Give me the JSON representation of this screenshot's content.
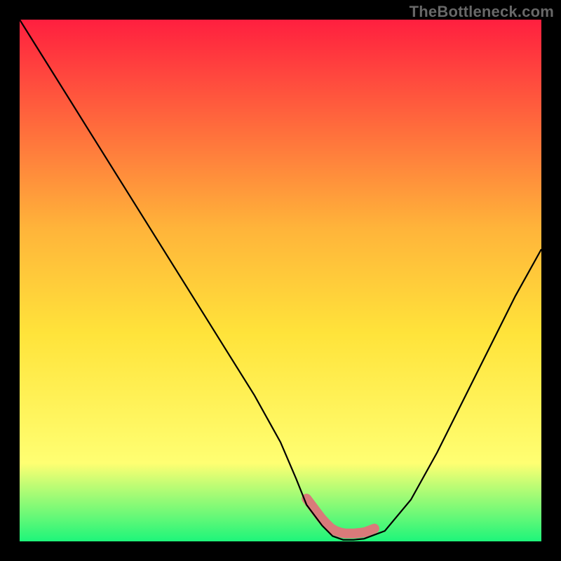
{
  "watermark": "TheBottleneck.com",
  "gradient": {
    "top": "#ff1f3f",
    "mid1": "#ffb43a",
    "mid2": "#ffe33a",
    "mid3": "#ffff72",
    "bottom": "#1ef57a"
  },
  "curve_color": "#000000",
  "curve_width": 2.2,
  "flat_marker_color": "#d97a7a",
  "flat_marker_width": 14,
  "chart_data": {
    "type": "line",
    "title": "",
    "xlabel": "",
    "ylabel": "",
    "xlim": [
      0,
      100
    ],
    "ylim": [
      0,
      100
    ],
    "x": [
      0,
      5,
      10,
      15,
      20,
      25,
      30,
      35,
      40,
      45,
      50,
      53,
      55,
      58,
      60,
      62,
      64,
      66,
      70,
      75,
      80,
      85,
      90,
      95,
      100
    ],
    "values": [
      100,
      92,
      84,
      76,
      68,
      60,
      52,
      44,
      36,
      28,
      19,
      12,
      7,
      3,
      1,
      0.3,
      0.3,
      0.5,
      2,
      8,
      17,
      27,
      37,
      47,
      56
    ],
    "flat_segment_xrange": [
      55,
      68
    ],
    "note": "Values are estimated from the bitmap. Axes are unlabeled; x and y treated as 0–100 percent. The curve descends from top-left, reaches ~0 near x≈62, stays near zero across ~55–68, then rises to ~56 at x=100. Pink rounded stroke highlights the near-flat bottom segment."
  }
}
